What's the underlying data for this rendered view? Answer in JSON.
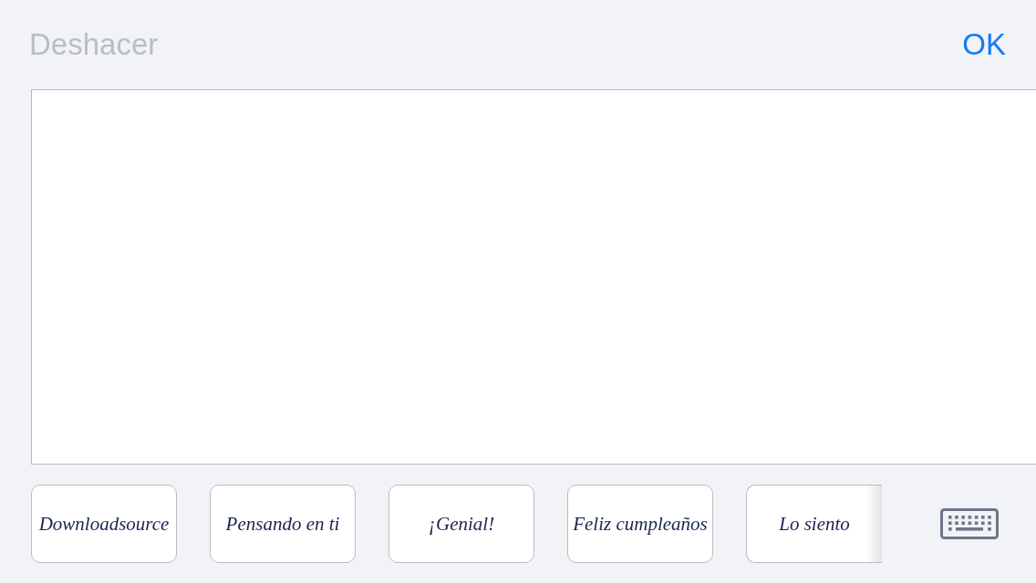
{
  "toolbar": {
    "undo": {
      "label": "Deshacer",
      "disabled": true
    },
    "done": {
      "label": "OK"
    }
  },
  "saved_phrases": [
    {
      "text": "Downloadsource",
      "cut_off": false
    },
    {
      "text": "Pensando en ti",
      "cut_off": false
    },
    {
      "text": "¡Genial!",
      "cut_off": false
    },
    {
      "text": "Feliz cumpleaños",
      "cut_off": false
    },
    {
      "text": "Lo siento",
      "cut_off": true
    }
  ]
}
